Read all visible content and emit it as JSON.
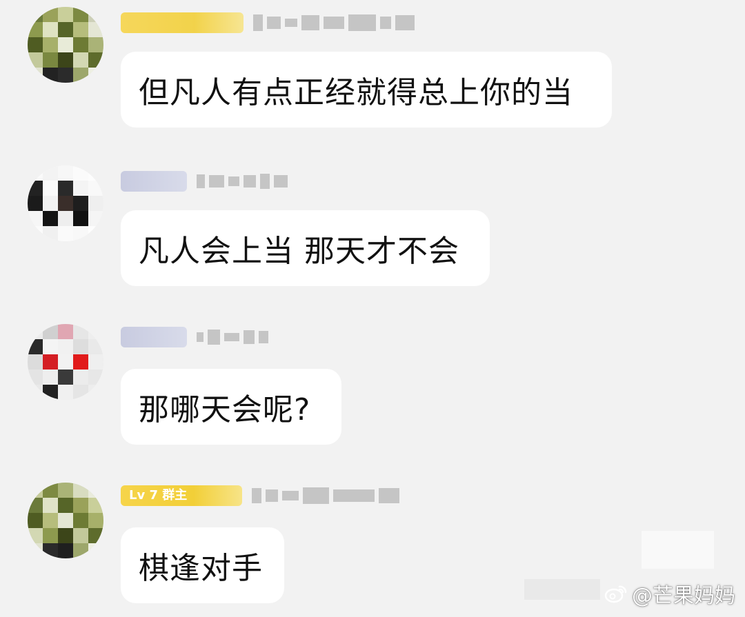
{
  "messages": [
    {
      "level_badge": "",
      "text": "但凡人有点正经就得总上你的当"
    },
    {
      "level_badge": "",
      "text": "凡人会上当 那天才不会"
    },
    {
      "level_badge": "",
      "text": "那哪天会呢?"
    },
    {
      "level_badge": "Lv 7  群主",
      "text": "棋逢对手"
    }
  ],
  "watermark": {
    "handle": "@芒果妈妈",
    "icon": "weibo-icon"
  },
  "colors": {
    "background": "#f2f2f2",
    "bubble": "#ffffff",
    "level_badge": "#f2cf38",
    "name_badge": "#c8cbe0"
  }
}
